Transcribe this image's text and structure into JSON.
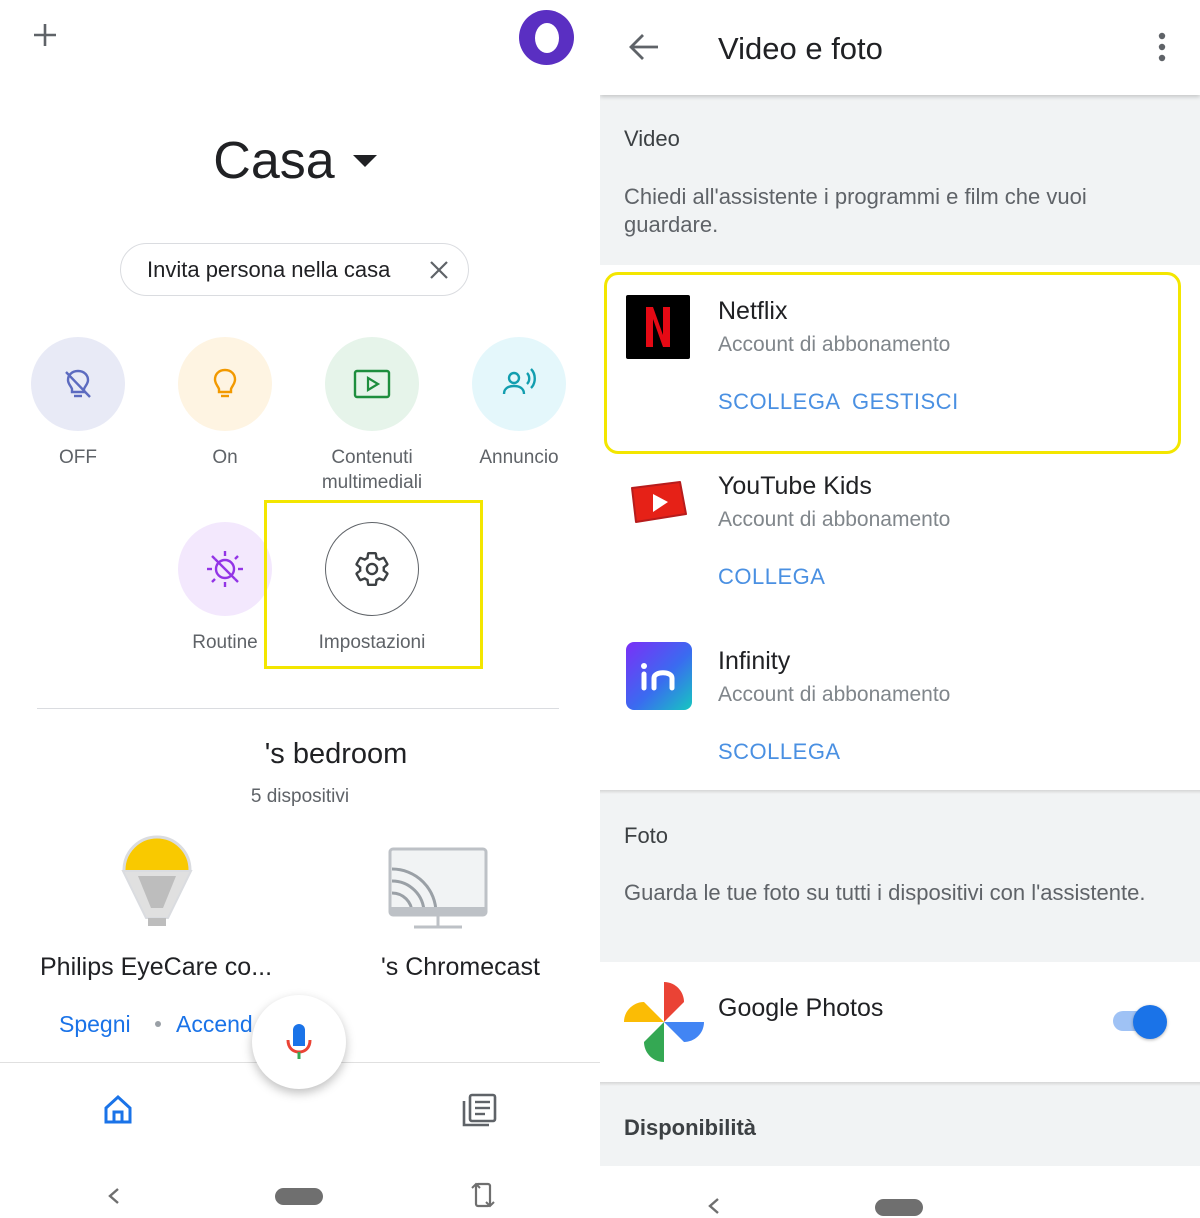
{
  "left": {
    "home_title": "Casa",
    "invite_chip": {
      "label": "Invita persona nella casa"
    },
    "actions": [
      {
        "label": "OFF",
        "bg": "#e8eaf6",
        "icon": "lightbulb-off-icon"
      },
      {
        "label": "On",
        "bg": "#fef4e2",
        "icon": "lightbulb-icon"
      },
      {
        "label": "Contenuti multimediali",
        "bg": "#e6f4ea",
        "icon": "play-media-icon"
      },
      {
        "label": "Annuncio",
        "bg": "#e4f7fb",
        "icon": "announce-icon"
      },
      {
        "label": "Routine",
        "bg": "#f3e8fd",
        "icon": "routine-icon"
      },
      {
        "label": "Impostazioni",
        "bg": "#ffffff",
        "icon": "gear-icon"
      }
    ],
    "room": {
      "title": "'s bedroom",
      "subtitle": "5 dispositivi"
    },
    "devices": [
      {
        "name": "Philips EyeCare co...",
        "links": [
          "Spegni",
          "Accend"
        ]
      },
      {
        "name": "'s Chromecast"
      }
    ],
    "highlight_color": "#f3e600"
  },
  "right": {
    "title": "Video e foto",
    "video_section": {
      "heading": "Video",
      "description": "Chiedi all'assistente i programmi e film che vuoi guardare."
    },
    "services": [
      {
        "name": "Netflix",
        "subtitle": "Account di abbonamento",
        "actions": [
          "SCOLLEGA",
          "GESTISCI"
        ],
        "icon": "netflix-icon"
      },
      {
        "name": "YouTube Kids",
        "subtitle": "Account di abbonamento",
        "actions": [
          "COLLEGA"
        ],
        "icon": "youtube-kids-icon"
      },
      {
        "name": "Infinity",
        "subtitle": "Account di abbonamento",
        "actions": [
          "SCOLLEGA"
        ],
        "icon": "infinity-icon"
      }
    ],
    "photo_section": {
      "heading": "Foto",
      "description": "Guarda le tue foto su tutti i dispositivi con l'assistente."
    },
    "google_photos": {
      "name": "Google Photos",
      "enabled": true
    },
    "availability_heading": "Disponibilità",
    "link_color": "#4a90e2"
  }
}
